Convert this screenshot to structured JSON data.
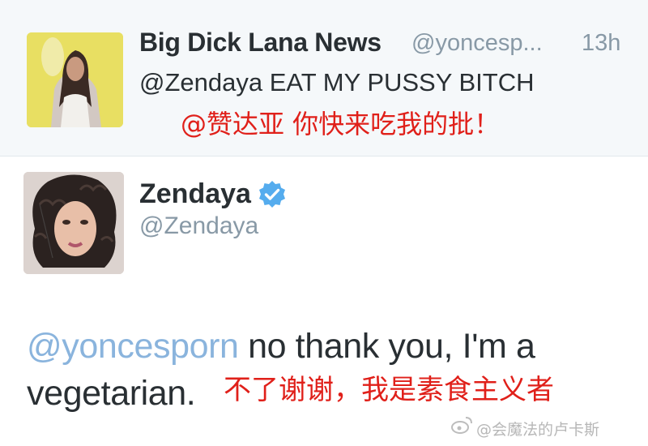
{
  "tweets": [
    {
      "display_name": "Big Dick Lana News",
      "handle": "@yoncesp...",
      "time": "13h",
      "text": "@Zendaya EAT MY PUSSY BITCH",
      "caption": "@赞达亚  你快来吃我的批！"
    },
    {
      "display_name": "Zendaya",
      "handle": "@Zendaya",
      "verified_icon": "verified-badge-icon",
      "mention": "@yoncesporn",
      "text_line1": " no thank you, I'm a",
      "text_line2": "vegetarian.",
      "caption": "不了谢谢，我是素食主义者"
    }
  ],
  "watermark": "@会魔法的卢卡斯",
  "colors": {
    "reply_bg": "#f5f8fa",
    "mention": "#8ab4dd",
    "caption_red": "#e0201a",
    "verified_blue": "#55acee",
    "muted": "#8899a6"
  }
}
